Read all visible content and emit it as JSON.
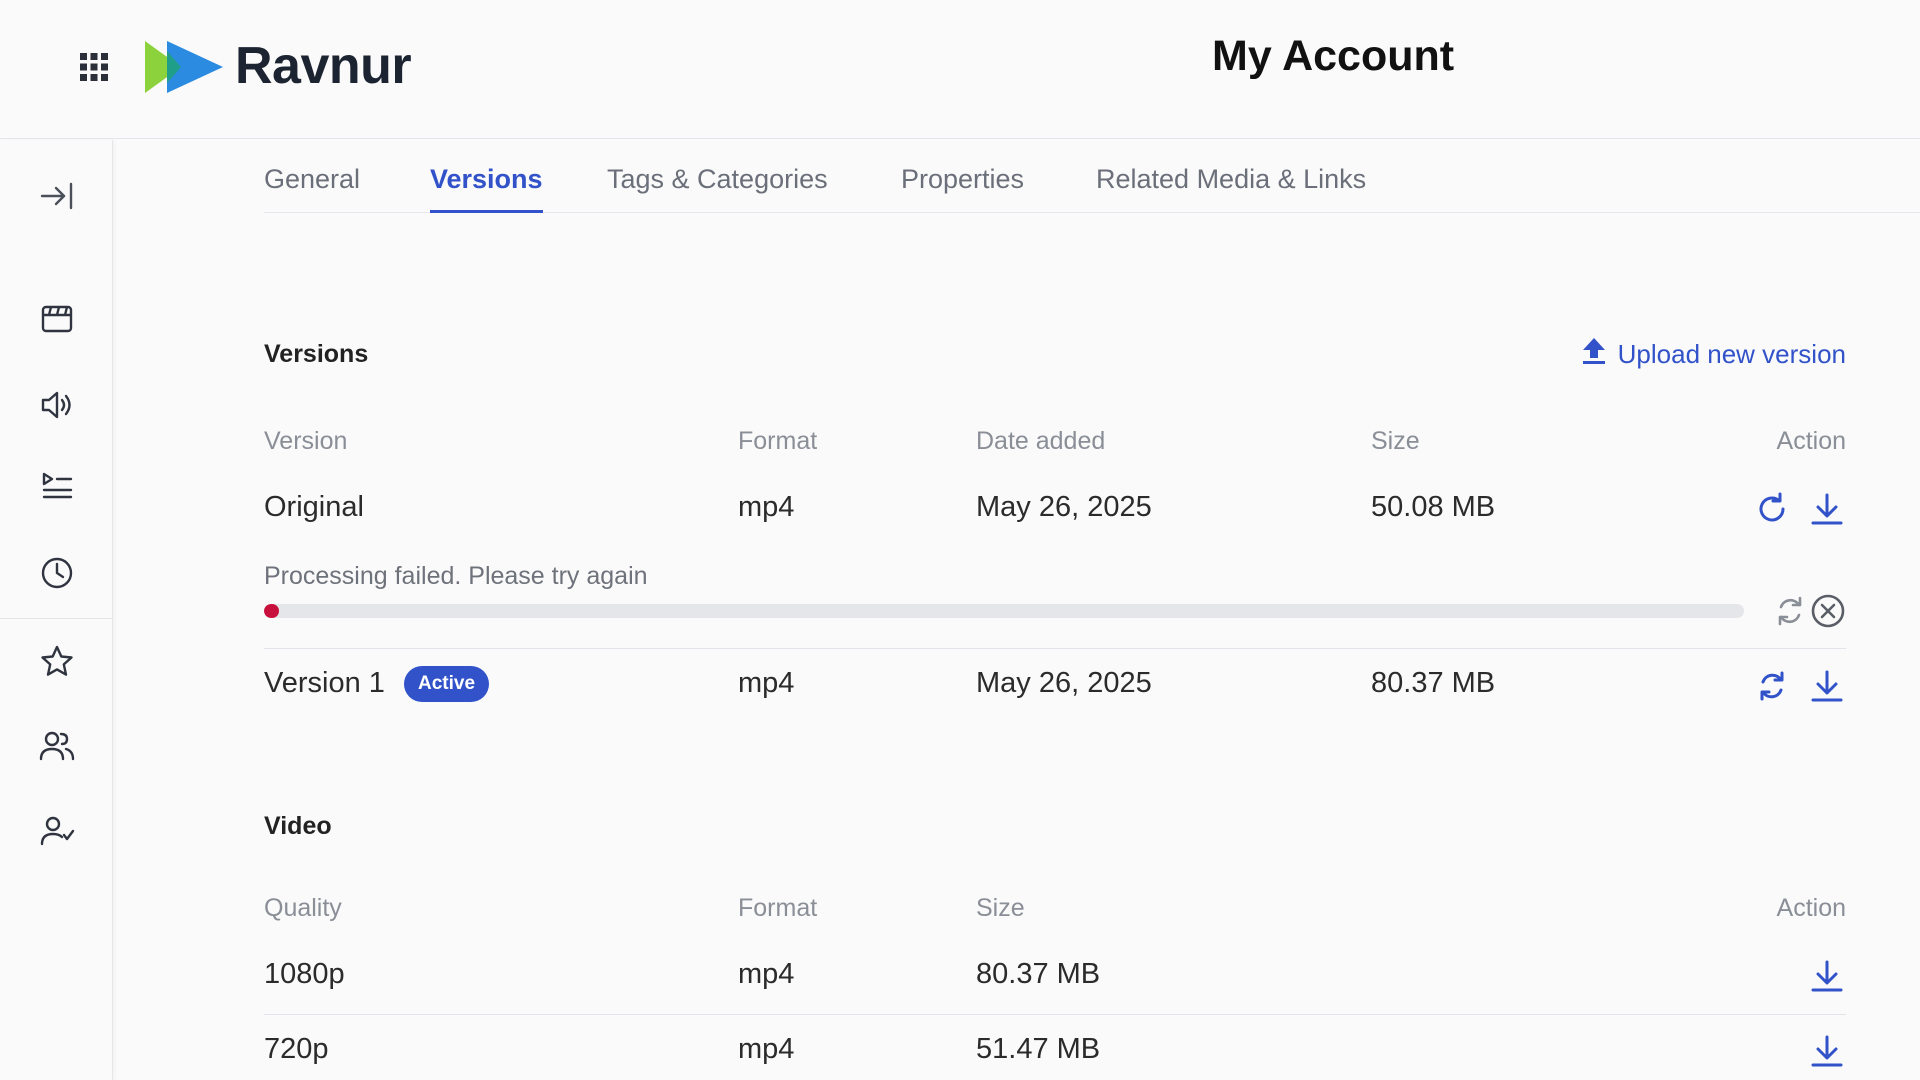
{
  "header": {
    "apps_icon": "grid-icon",
    "logo_text": "Ravnur",
    "page_title": "My Account"
  },
  "sidebar": {
    "items": [
      {
        "name": "expand",
        "icon": "expand-sidebar-icon"
      },
      {
        "name": "media",
        "icon": "media-icon"
      },
      {
        "name": "audio",
        "icon": "speaker-icon"
      },
      {
        "name": "playlists",
        "icon": "playlist-icon"
      },
      {
        "name": "history",
        "icon": "clock-icon"
      },
      {
        "name": "favorites",
        "icon": "star-icon"
      },
      {
        "name": "groups",
        "icon": "users-icon"
      },
      {
        "name": "approvals",
        "icon": "user-check-icon"
      }
    ]
  },
  "tabs": [
    {
      "label": "General",
      "active": false
    },
    {
      "label": "Versions",
      "active": true
    },
    {
      "label": "Tags & Categories",
      "active": false
    },
    {
      "label": "Properties",
      "active": false
    },
    {
      "label": "Related Media & Links",
      "active": false
    }
  ],
  "versions": {
    "title": "Versions",
    "upload_label": "Upload new version",
    "columns": [
      "Version",
      "Format",
      "Date added",
      "Size",
      "Action"
    ],
    "rows": [
      {
        "version": "Original",
        "format": "mp4",
        "date": "May 26, 2025",
        "size": "50.08 MB",
        "actions": [
          "refresh-icon",
          "download-icon"
        ]
      },
      {
        "version": "Version 1",
        "badge": "Active",
        "format": "mp4",
        "date": "May 26, 2025",
        "size": "80.37 MB",
        "actions": [
          "sync-icon",
          "download-icon"
        ]
      }
    ],
    "processing": {
      "message": "Processing failed. Please try again",
      "progress_percent": 1,
      "color": "#c8103c",
      "actions": [
        "retry-icon",
        "cancel-icon"
      ]
    }
  },
  "video": {
    "title": "Video",
    "columns": [
      "Quality",
      "Format",
      "Size",
      "Action"
    ],
    "rows": [
      {
        "quality": "1080p",
        "format": "mp4",
        "size": "80.37 MB",
        "action": "download-icon"
      },
      {
        "quality": "720p",
        "format": "mp4",
        "size": "51.47 MB",
        "action": "download-icon"
      }
    ]
  },
  "colors": {
    "accent": "#3152c9",
    "error": "#c8103c",
    "logo_green": "#8cd23c",
    "logo_blue": "#2a8be0"
  }
}
